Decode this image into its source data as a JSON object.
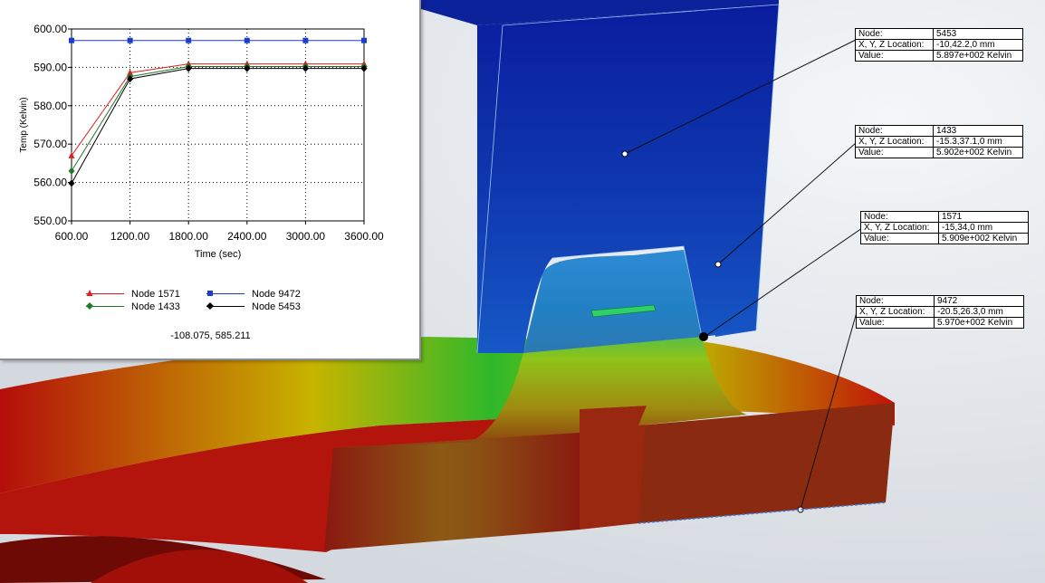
{
  "probes": [
    {
      "node_label": "Node:",
      "node": "5453",
      "loc_label": "X, Y, Z Location:",
      "loc": "-10,42.2,0 mm",
      "value_label": "Value:",
      "value": "5.897e+002 Kelvin"
    },
    {
      "node_label": "Node:",
      "node": "1433",
      "loc_label": "X, Y, Z Location:",
      "loc": "-15.3,37.1,0 mm",
      "value_label": "Value:",
      "value": "5.902e+002 Kelvin"
    },
    {
      "node_label": "Node:",
      "node": "1571",
      "loc_label": "X, Y, Z Location:",
      "loc": "-15,34,0 mm",
      "value_label": "Value:",
      "value": "5.909e+002 Kelvin"
    },
    {
      "node_label": "Node:",
      "node": "9472",
      "loc_label": "X, Y, Z Location:",
      "loc": "-20.5,26.3,0 mm",
      "value_label": "Value:",
      "value": "5.970e+002 Kelvin"
    }
  ],
  "graph": {
    "cursor_readout": "-108.075, 585.211",
    "chart_data": {
      "type": "line",
      "xlabel": "Time (sec)",
      "ylabel": "Temp (Kelvin)",
      "xlim": [
        600,
        3600
      ],
      "ylim": [
        550,
        600
      ],
      "x": [
        600,
        1200,
        1800,
        2400,
        3000,
        3600
      ],
      "x_tick_labels": [
        "600.00",
        "1200.00",
        "1800.00",
        "2400.00",
        "3000.00",
        "3600.00"
      ],
      "y_ticks": [
        550,
        560,
        570,
        580,
        590,
        600
      ],
      "y_tick_labels": [
        "550.00",
        "560.00",
        "570.00",
        "580.00",
        "590.00",
        "600.00"
      ],
      "grid": true,
      "legend_position": "bottom",
      "series": [
        {
          "name": "Node 1571",
          "color": "#e02020",
          "marker": "triangle",
          "values": [
            567.0,
            588.6,
            590.9,
            590.9,
            590.9,
            590.9
          ]
        },
        {
          "name": "Node 9472",
          "color": "#1a3fd0",
          "marker": "square",
          "values": [
            597.0,
            597.0,
            597.0,
            597.0,
            597.0,
            597.0
          ]
        },
        {
          "name": "Node 1433",
          "color": "#1d7a2a",
          "marker": "diamond",
          "values": [
            563.0,
            587.6,
            590.2,
            590.2,
            590.2,
            590.2
          ]
        },
        {
          "name": "Node 5453",
          "color": "#000000",
          "marker": "diamond",
          "values": [
            559.8,
            587.0,
            589.7,
            589.7,
            589.7,
            589.7
          ]
        }
      ]
    }
  }
}
